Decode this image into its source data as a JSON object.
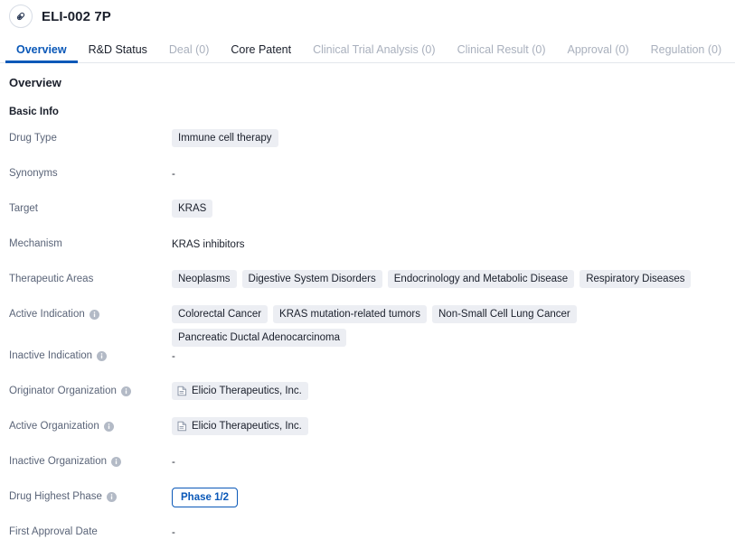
{
  "header": {
    "icon": "capsule-icon",
    "title": "ELI-002 7P"
  },
  "tabs": [
    {
      "label": "Overview",
      "active": true,
      "disabled": false
    },
    {
      "label": "R&D Status",
      "active": false,
      "disabled": false
    },
    {
      "label": "Deal (0)",
      "active": false,
      "disabled": true
    },
    {
      "label": "Core Patent",
      "active": false,
      "disabled": false
    },
    {
      "label": "Clinical Trial Analysis (0)",
      "active": false,
      "disabled": true
    },
    {
      "label": "Clinical Result (0)",
      "active": false,
      "disabled": true
    },
    {
      "label": "Approval (0)",
      "active": false,
      "disabled": true
    },
    {
      "label": "Regulation (0)",
      "active": false,
      "disabled": true
    }
  ],
  "main": {
    "section_title": "Overview",
    "subsection_title": "Basic Info",
    "empty_marker": "-",
    "fields": [
      {
        "label": "Drug Type",
        "info": false,
        "type": "chips",
        "values": [
          "Immune cell therapy"
        ]
      },
      {
        "label": "Synonyms",
        "info": false,
        "type": "empty",
        "values": []
      },
      {
        "label": "Target",
        "info": false,
        "type": "chips",
        "values": [
          "KRAS"
        ]
      },
      {
        "label": "Mechanism",
        "info": false,
        "type": "text",
        "values": [
          "KRAS inhibitors"
        ]
      },
      {
        "label": "Therapeutic Areas",
        "info": false,
        "type": "chips",
        "values": [
          "Neoplasms",
          "Digestive System Disorders",
          "Endocrinology and Metabolic Disease",
          "Respiratory Diseases"
        ]
      },
      {
        "label": "Active Indication",
        "info": true,
        "type": "chips",
        "values": [
          "Colorectal Cancer",
          "KRAS mutation-related tumors",
          "Non-Small Cell Lung Cancer",
          "Pancreatic Ductal Adenocarcinoma"
        ]
      },
      {
        "label": "Inactive Indication",
        "info": true,
        "type": "empty",
        "values": []
      },
      {
        "label": "Originator Organization",
        "info": true,
        "type": "org-chips",
        "values": [
          "Elicio Therapeutics, Inc."
        ]
      },
      {
        "label": "Active Organization",
        "info": true,
        "type": "org-chips",
        "values": [
          "Elicio Therapeutics, Inc."
        ]
      },
      {
        "label": "Inactive Organization",
        "info": true,
        "type": "empty",
        "values": []
      },
      {
        "label": "Drug Highest Phase",
        "info": true,
        "type": "outline-chip",
        "values": [
          "Phase 1/2"
        ]
      },
      {
        "label": "First Approval Date",
        "info": false,
        "type": "empty",
        "values": []
      }
    ]
  },
  "colors": {
    "accent": "#0a58b8",
    "chip_bg": "#eceef3",
    "label_text": "#5a6478",
    "body_text": "#1a1f2b",
    "disabled_tab": "#a9b0bd",
    "border": "#e3e6ec"
  }
}
